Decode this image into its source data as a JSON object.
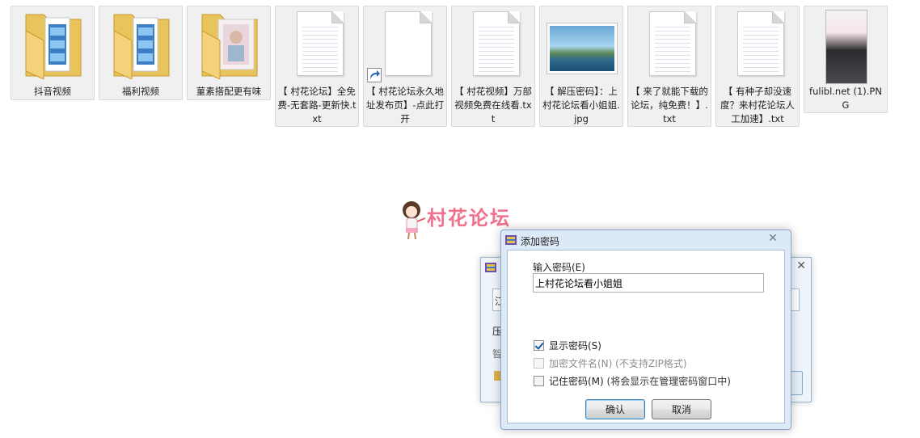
{
  "files": [
    {
      "name": "抖音视频",
      "kind": "folder"
    },
    {
      "name": "福利视频",
      "kind": "folder"
    },
    {
      "name": "菫素搭配更有味",
      "kind": "folder-image"
    },
    {
      "name": "【 村花论坛】全免费-无套路-更新快.txt",
      "kind": "txt"
    },
    {
      "name": "【 村花论坛永久地址发布页】-点此打开",
      "kind": "shortcut"
    },
    {
      "name": "【 村花视频】万部视频免费在线看.txt",
      "kind": "txt"
    },
    {
      "name": "【 解压密码】：上村花论坛看小姐姐.jpg",
      "kind": "jpg"
    },
    {
      "name": "【 来了就能下载的论坛，纯免费！】.txt",
      "kind": "txt"
    },
    {
      "name": "【 有种子却没速度？来村花论坛人工加速】.txt",
      "kind": "txt"
    },
    {
      "name": "fulibl.net (1).PNG",
      "kind": "png"
    }
  ],
  "logo": {
    "text": "村花论坛"
  },
  "background_dialog": {
    "title": "x",
    "field_value": "江",
    "label1": "压",
    "label2": "智"
  },
  "dialog": {
    "title": "添加密码",
    "close_symbol": "✕",
    "password_label": "输入密码(E)",
    "password_value": "上村花论坛看小姐姐",
    "options": [
      {
        "label": "显示密码(S)",
        "note": "",
        "checked": true,
        "enabled": true
      },
      {
        "label": "加密文件名(N)",
        "note": "(不支持ZIP格式)",
        "checked": false,
        "enabled": false
      },
      {
        "label": "记住密码(M)",
        "note": "(将会显示在管理密码窗口中)",
        "checked": false,
        "enabled": true
      }
    ],
    "ok_label": "确认",
    "cancel_label": "取消"
  },
  "colors": {
    "logo_pink": "#f0708d",
    "dialog_frame": "#dce9f7",
    "check_blue": "#1c5ca8"
  }
}
